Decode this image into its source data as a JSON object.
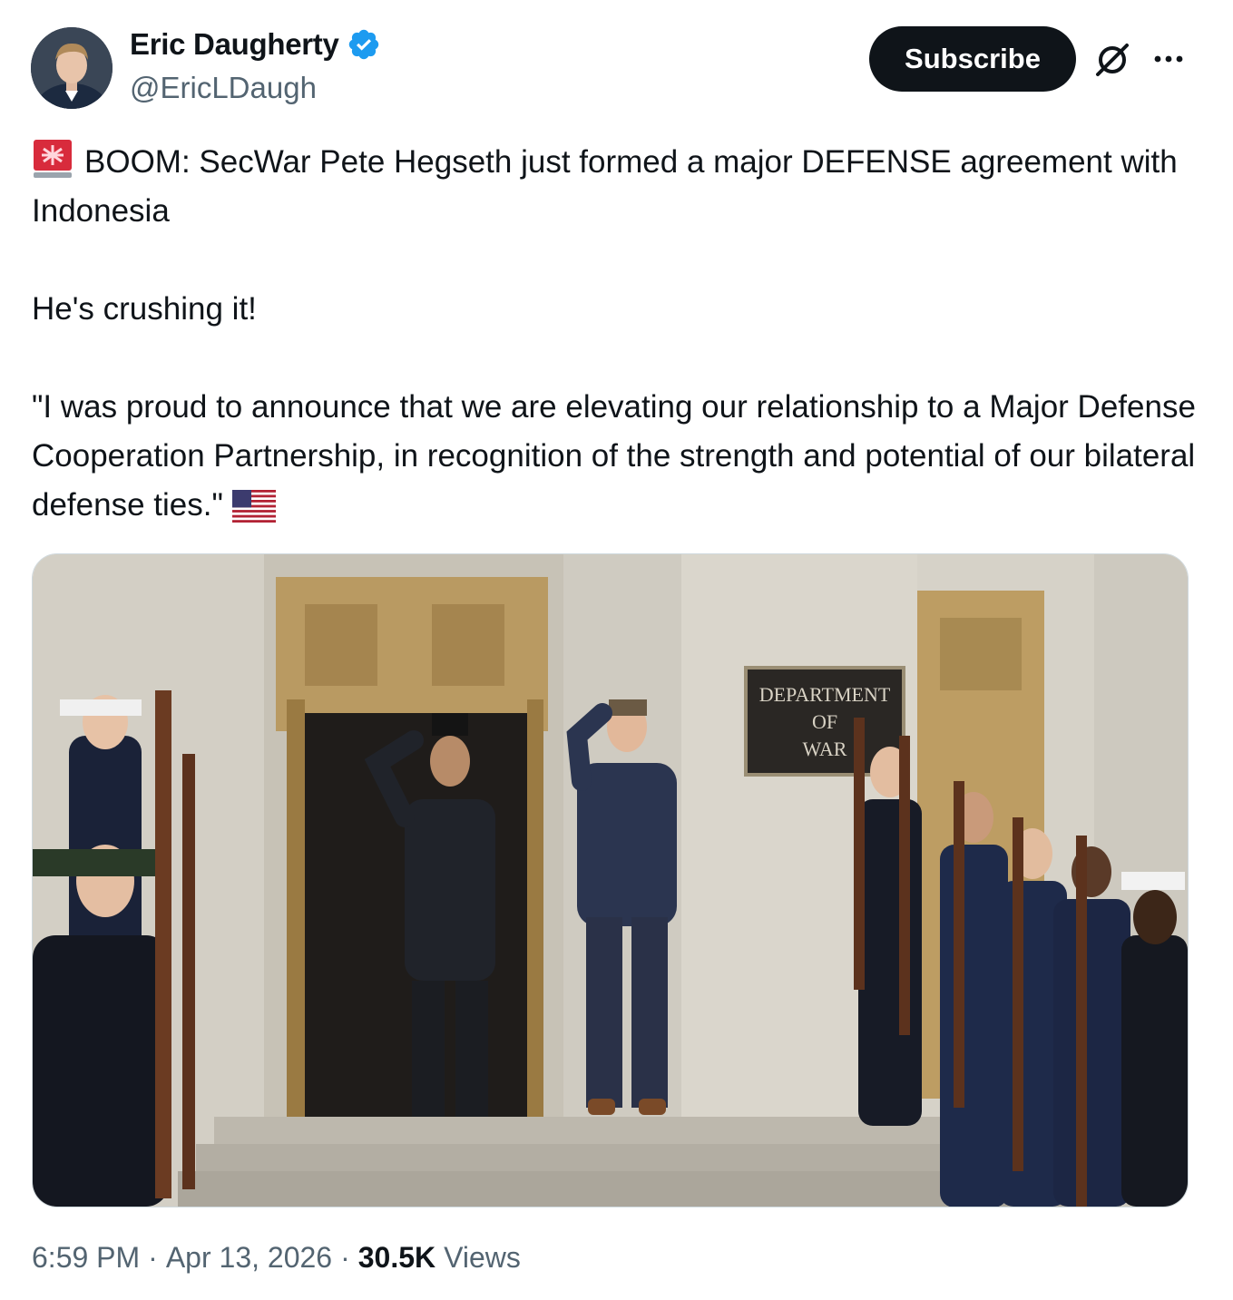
{
  "author": {
    "display_name": "Eric Daugherty",
    "handle": "@EricLDaugh",
    "verified": true
  },
  "header": {
    "subscribe_label": "Subscribe"
  },
  "icons": {
    "avatar": "avatar",
    "verified": "verified-badge-icon",
    "grok": "grok-icon",
    "more": "more-icon",
    "siren": "rotating-light-emoji",
    "flag": "us-flag-emoji"
  },
  "tweet": {
    "line1": "BOOM: SecWar Pete Hegseth just formed a major DEFENSE agreement with Indonesia",
    "line2": "He's crushing it!",
    "line3": "\"I was proud to announce that we are elevating our relationship to a Major Defense Cooperation Partnership, in recognition of the strength and potential of our bilateral defense ties.\""
  },
  "media": {
    "sign_text": [
      "DEPARTMENT",
      "OF",
      "WAR"
    ]
  },
  "meta": {
    "time": "6:59 PM",
    "date": "Apr 13, 2026",
    "views_count": "30.5K",
    "views_label": "Views"
  },
  "colors": {
    "text_primary": "#0f1419",
    "text_secondary": "#536471",
    "verified_blue": "#1d9bf0",
    "button_bg": "#0f1419"
  }
}
